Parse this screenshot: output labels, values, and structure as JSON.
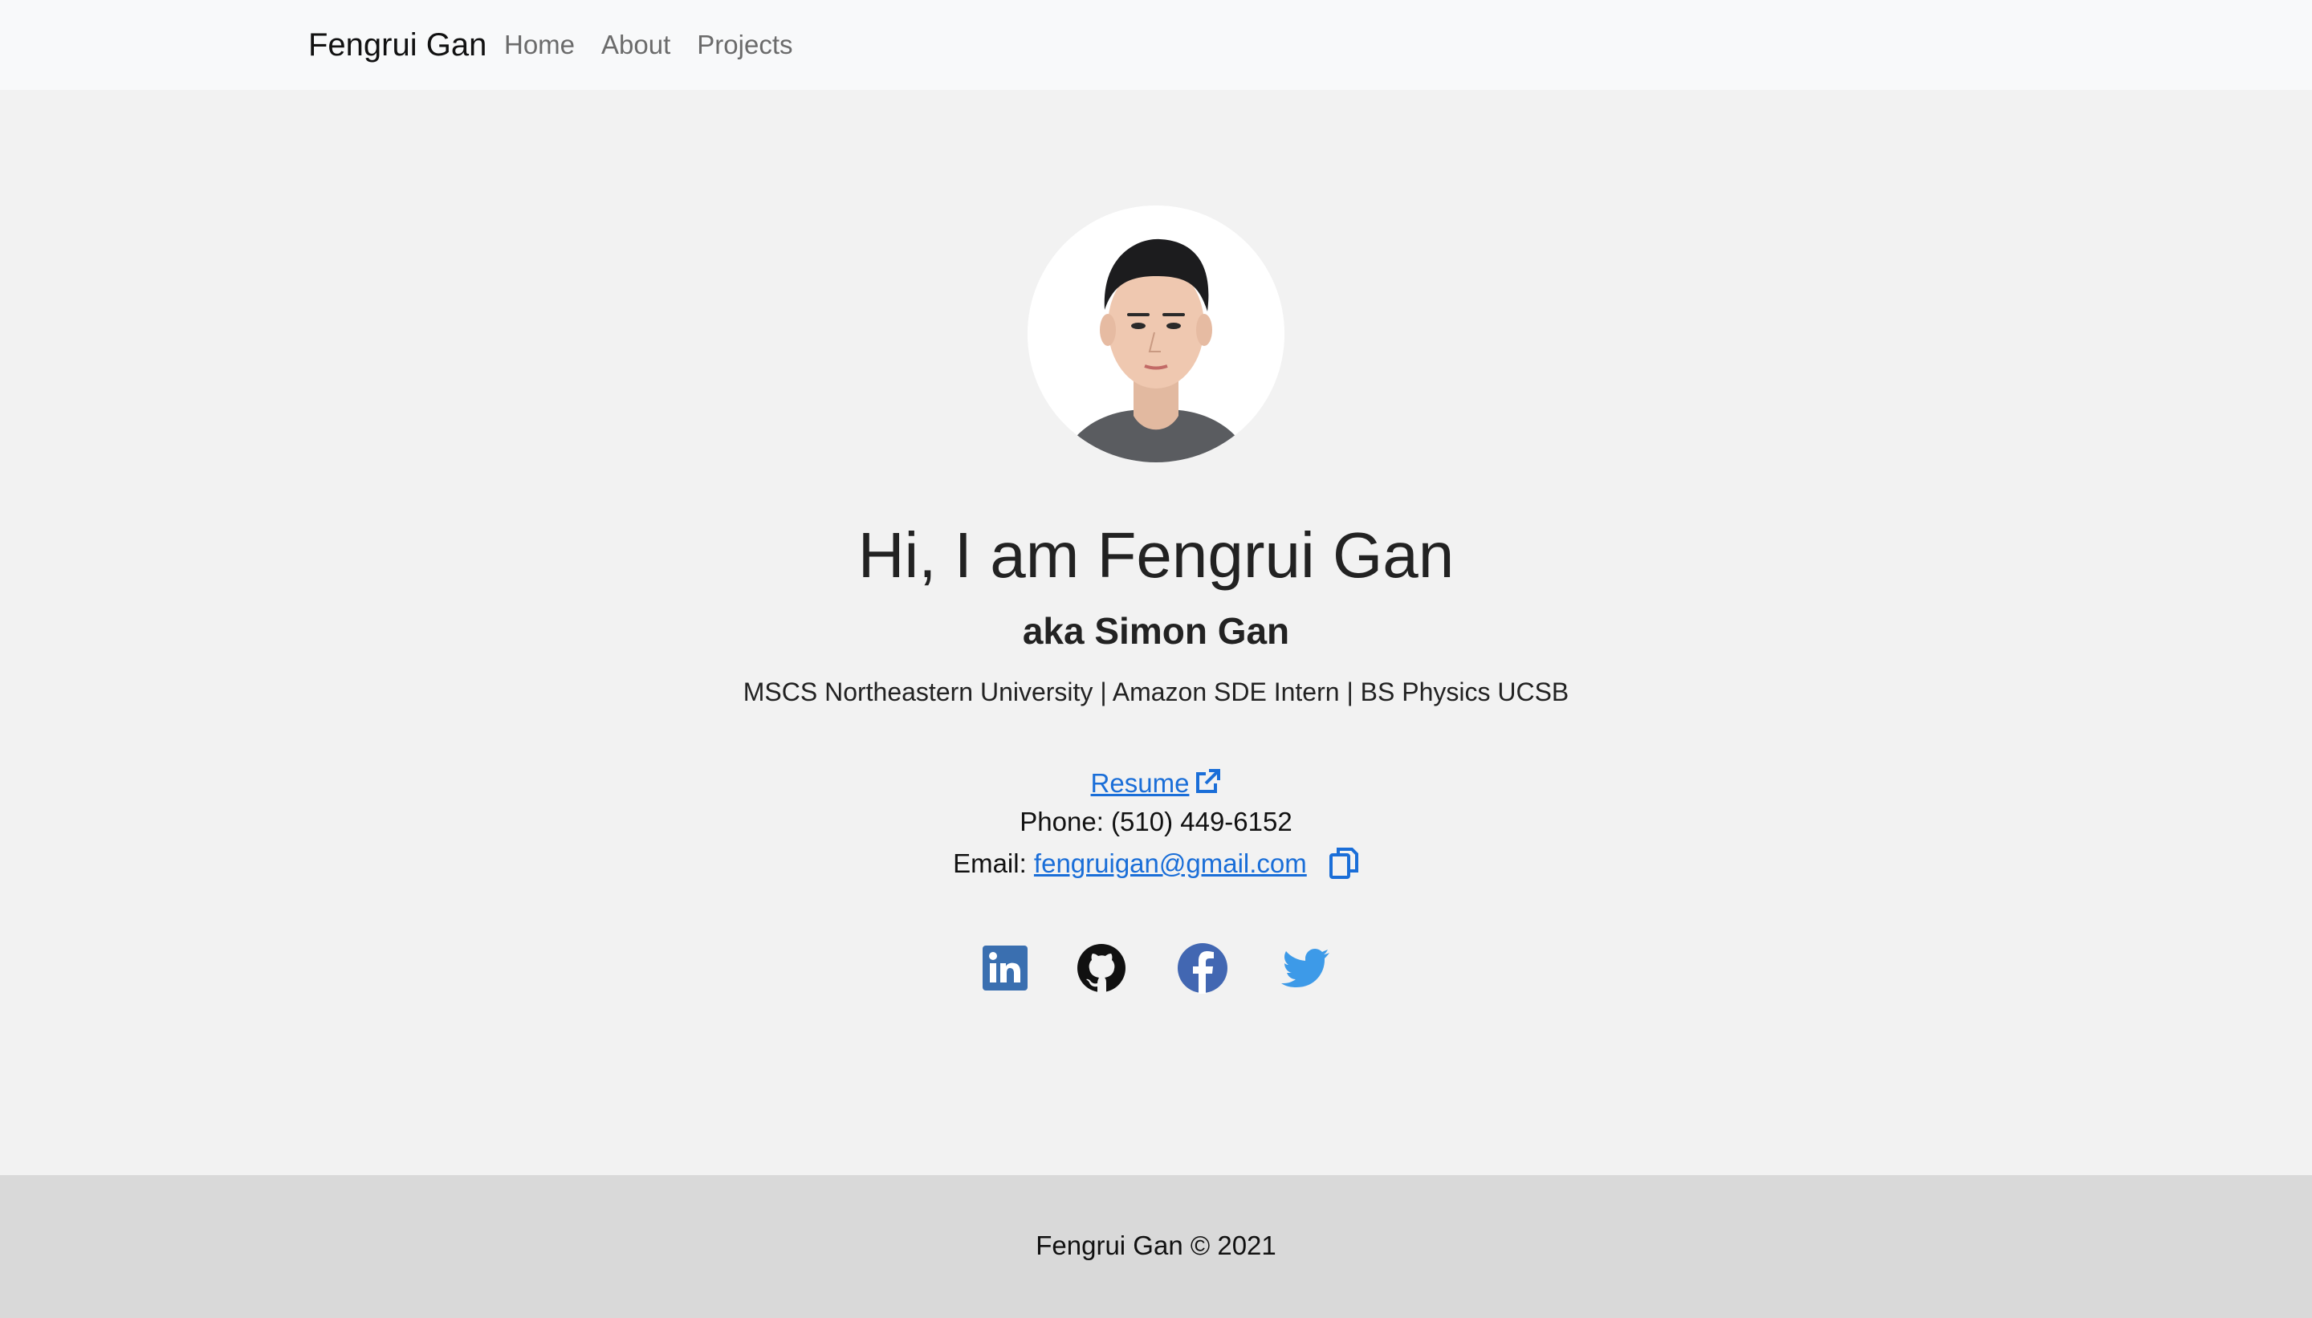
{
  "navbar": {
    "brand": "Fengrui Gan",
    "links": [
      "Home",
      "About",
      "Projects"
    ]
  },
  "hero": {
    "avatar_alt": "profile photo",
    "title": "Hi, I am Fengrui Gan",
    "subtitle": "aka Simon Gan",
    "description": "MSCS Northeastern University | Amazon SDE Intern | BS Physics UCSB"
  },
  "contact": {
    "resume_label": "Resume",
    "resume_icon": "external-link-icon",
    "phone_label": "Phone:",
    "phone_value": "(510) 449-6152",
    "email_label": "Email:",
    "email_value": "fengruigan@gmail.com",
    "copy_icon": "copy-icon"
  },
  "socials": [
    {
      "name": "linkedin",
      "icon": "linkedin-icon",
      "color": "#3a6fb0"
    },
    {
      "name": "github",
      "icon": "github-icon",
      "color": "#111111"
    },
    {
      "name": "facebook",
      "icon": "facebook-icon",
      "color": "#4267b2"
    },
    {
      "name": "twitter",
      "icon": "twitter-icon",
      "color": "#3d9ae8"
    }
  ],
  "footer": {
    "text": "Fengrui Gan © 2021"
  },
  "colors": {
    "link": "#1a6ed8",
    "background": "#f2f2f2",
    "navbar_bg": "#f8f9fa",
    "footer_bg": "#d9d9d9"
  }
}
